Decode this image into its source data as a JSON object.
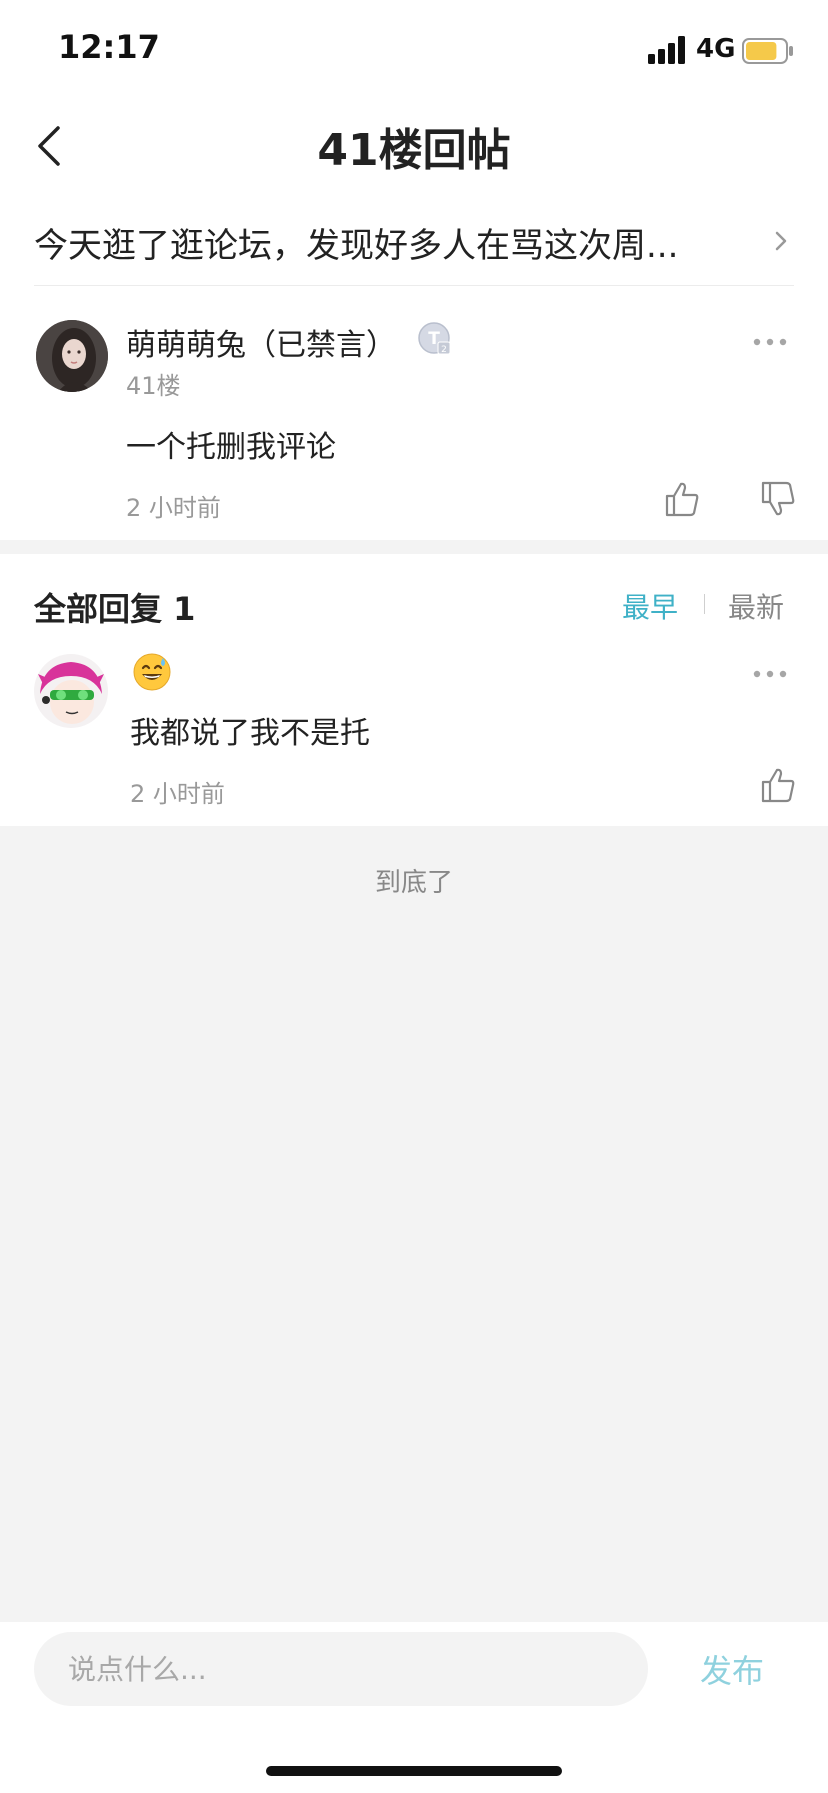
{
  "status_bar": {
    "time": "12:17",
    "network": "4G",
    "battery_level": 0.8,
    "battery_color": "#f5c94a"
  },
  "nav": {
    "title": "41楼回帖",
    "back_icon": "chevron-left-icon"
  },
  "thread": {
    "title": "今天逛了逛论坛，发现好多人在骂这次周...",
    "chevron_icon": "chevron-right-icon"
  },
  "post": {
    "username": "萌萌萌兔（已禁言）",
    "badge_icon": "level-t2-badge-icon",
    "floor": "41楼",
    "content": "一个托删我评论",
    "time": "2 小时前",
    "more_icon": "more-dots-icon",
    "like_icon": "thumbs-up-icon",
    "dislike_icon": "thumbs-down-icon"
  },
  "replies": {
    "header": "全部回复 1",
    "sort_earliest": "最早",
    "sort_newest": "最新",
    "active_sort_color": "#3fb1c7",
    "items": [
      {
        "emoji": "😅",
        "content": "我都说了我不是托",
        "time": "2 小时前"
      }
    ]
  },
  "end_text": "到底了",
  "composer": {
    "placeholder": "说点什么...",
    "publish_label": "发布",
    "publish_color": "#8fd1de"
  }
}
